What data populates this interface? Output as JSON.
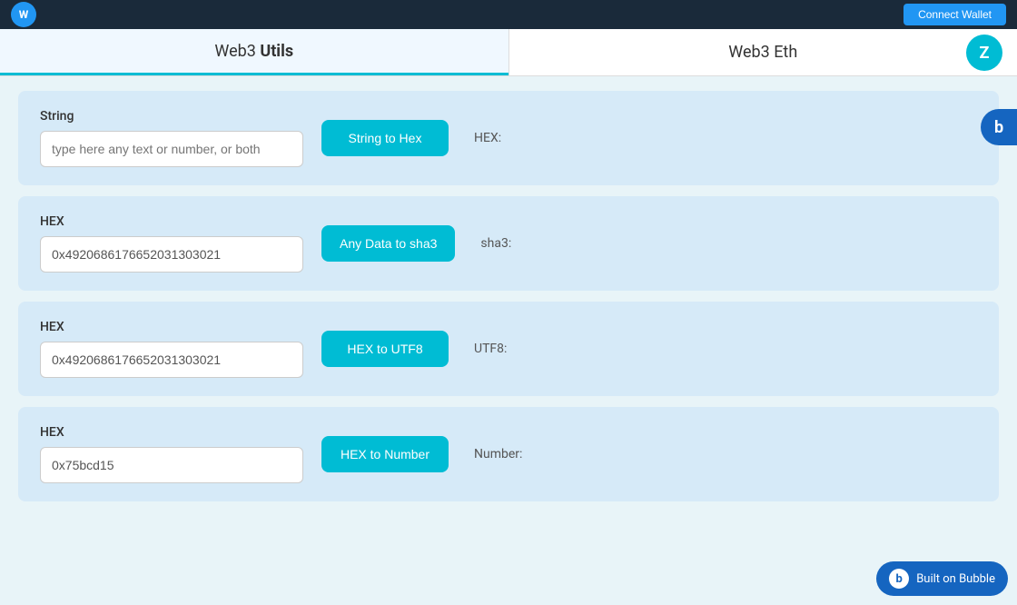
{
  "nav": {
    "logo_text": "W",
    "button_label": "Connect Wallet"
  },
  "tabs": [
    {
      "id": "web3utils",
      "label_prefix": "Web3 ",
      "label_bold": "Utils",
      "active": true
    },
    {
      "id": "web3eth",
      "label": "Web3 Eth",
      "active": false
    }
  ],
  "tab_icon": "Z",
  "bubble_side_icon": "b",
  "cards": [
    {
      "id": "string-to-hex",
      "input_label": "String",
      "input_placeholder": "type here any text or number, or both",
      "input_value": "",
      "button_label": "String to Hex",
      "result_label": "HEX:"
    },
    {
      "id": "any-data-to-sha3",
      "input_label": "HEX",
      "input_placeholder": "",
      "input_value": "0x4920686176652031303021",
      "button_label": "Any Data to sha3",
      "result_label": "sha3:"
    },
    {
      "id": "hex-to-utf8",
      "input_label": "HEX",
      "input_placeholder": "",
      "input_value": "0x4920686176652031303021",
      "button_label": "HEX to UTF8",
      "result_label": "UTF8:"
    },
    {
      "id": "hex-to-number",
      "input_label": "HEX",
      "input_placeholder": "",
      "input_value": "0x75bcd15",
      "button_label": "HEX to Number",
      "result_label": "Number:"
    }
  ],
  "built_on_bubble": {
    "icon": "b",
    "label": "Built on Bubble"
  }
}
